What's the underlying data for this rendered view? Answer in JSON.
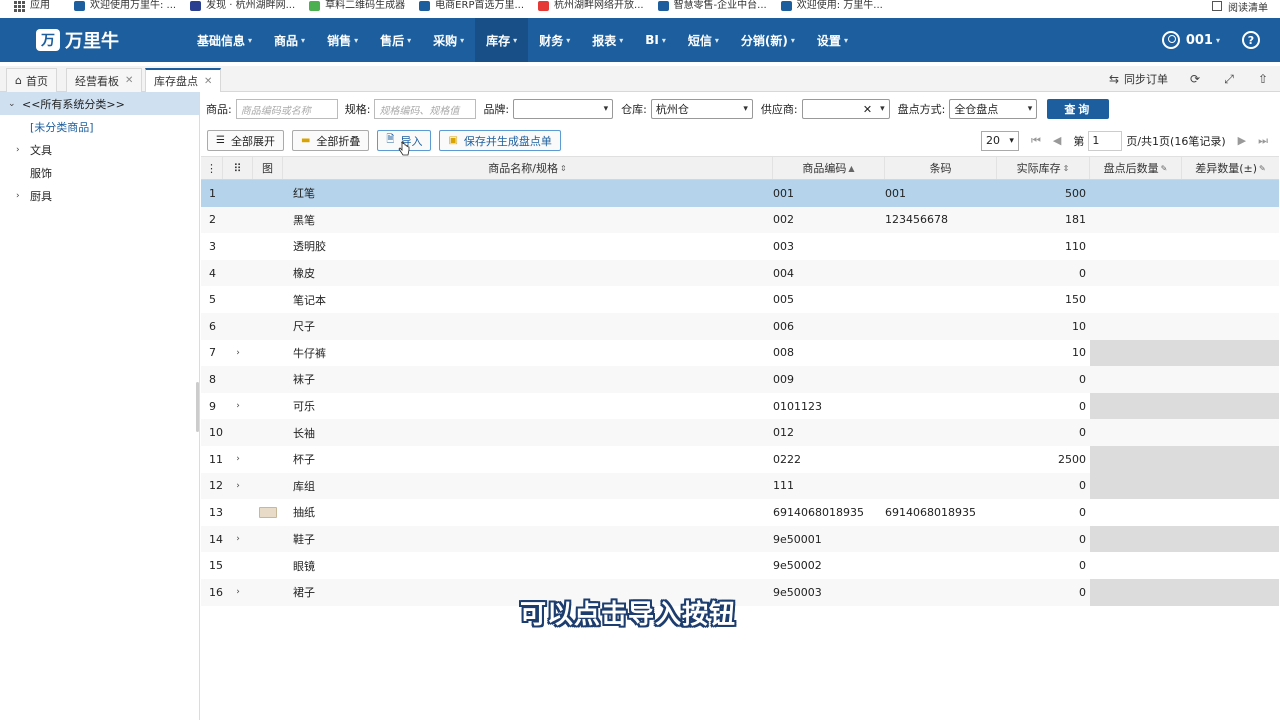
{
  "bookmarks": {
    "apps_label": "应用",
    "items": [
      {
        "label": "欢迎使用万里牛: ...",
        "color": "#1d5f9e"
      },
      {
        "label": "发现 · 杭州湖畔网...",
        "color": "#2a3f8f"
      },
      {
        "label": "草料二维码生成器",
        "color": "#4caf50"
      },
      {
        "label": "电商ERP首选万里...",
        "color": "#1d5f9e"
      },
      {
        "label": "杭州湖畔网络开放...",
        "color": "#e53935"
      },
      {
        "label": "智慧零售-企业中台...",
        "color": "#1d5f9e"
      },
      {
        "label": "欢迎使用: 万里牛...",
        "color": "#1d5f9e"
      }
    ],
    "reading_list": "阅读清单"
  },
  "header": {
    "logo_text": "万里牛",
    "menu": [
      {
        "label": "基础信息",
        "active": false
      },
      {
        "label": "商品",
        "active": false
      },
      {
        "label": "销售",
        "active": false
      },
      {
        "label": "售后",
        "active": false
      },
      {
        "label": "采购",
        "active": false
      },
      {
        "label": "库存",
        "active": true
      },
      {
        "label": "财务",
        "active": false
      },
      {
        "label": "报表",
        "active": false
      },
      {
        "label": "BI",
        "active": false
      },
      {
        "label": "短信",
        "active": false
      },
      {
        "label": "分销(新)",
        "active": false
      },
      {
        "label": "设置",
        "active": false
      }
    ],
    "user": "001"
  },
  "tabs": {
    "items": [
      {
        "label": "首页"
      },
      {
        "label": "经营看板"
      },
      {
        "label": "库存盘点"
      }
    ],
    "sync_label": "同步订单"
  },
  "sidebar": {
    "root": "<<所有系统分类>>",
    "items": [
      {
        "label": "[未分类商品]"
      },
      {
        "label": "文具"
      },
      {
        "label": "服饰"
      },
      {
        "label": "厨具"
      }
    ]
  },
  "filters": {
    "product_label": "商品:",
    "product_placeholder": "商品编码或名称",
    "spec_label": "规格:",
    "spec_placeholder": "规格编码、规格值",
    "brand_label": "品牌:",
    "brand_value": "",
    "warehouse_label": "仓库:",
    "warehouse_value": "杭州仓",
    "supplier_label": "供应商:",
    "supplier_value": "",
    "method_label": "盘点方式:",
    "method_value": "全仓盘点",
    "query_label": "查询"
  },
  "actions": {
    "expand_all": "全部展开",
    "collapse_all": "全部折叠",
    "import": "导入",
    "save_generate": "保存并生成盘点单"
  },
  "pager": {
    "page_size": "20",
    "page_prefix": "第",
    "page_value": "1",
    "page_suffix": "页/共1页(16笔记录)"
  },
  "table": {
    "headers": {
      "image": "图",
      "name": "商品名称/规格",
      "code": "商品编码",
      "barcode": "条码",
      "stock": "实际库存",
      "counted": "盘点后数量",
      "diff": "差异数量(±)"
    },
    "rows": [
      {
        "num": "1",
        "expand": false,
        "image": false,
        "name": "红笔",
        "code": "001",
        "barcode": "001",
        "stock": "500",
        "grey": false
      },
      {
        "num": "2",
        "expand": false,
        "image": false,
        "name": "黑笔",
        "code": "002",
        "barcode": "123456678",
        "stock": "181",
        "grey": false
      },
      {
        "num": "3",
        "expand": false,
        "image": false,
        "name": "透明胶",
        "code": "003",
        "barcode": "",
        "stock": "110",
        "grey": false
      },
      {
        "num": "4",
        "expand": false,
        "image": false,
        "name": "橡皮",
        "code": "004",
        "barcode": "",
        "stock": "0",
        "grey": false
      },
      {
        "num": "5",
        "expand": false,
        "image": false,
        "name": "笔记本",
        "code": "005",
        "barcode": "",
        "stock": "150",
        "grey": false
      },
      {
        "num": "6",
        "expand": false,
        "image": false,
        "name": "尺子",
        "code": "006",
        "barcode": "",
        "stock": "10",
        "grey": false
      },
      {
        "num": "7",
        "expand": true,
        "image": false,
        "name": "牛仔裤",
        "code": "008",
        "barcode": "",
        "stock": "10",
        "grey": true
      },
      {
        "num": "8",
        "expand": false,
        "image": false,
        "name": "袜子",
        "code": "009",
        "barcode": "",
        "stock": "0",
        "grey": false
      },
      {
        "num": "9",
        "expand": true,
        "image": false,
        "name": "可乐",
        "code": "0101123",
        "barcode": "",
        "stock": "0",
        "grey": true
      },
      {
        "num": "10",
        "expand": false,
        "image": false,
        "name": "长袖",
        "code": "012",
        "barcode": "",
        "stock": "0",
        "grey": false
      },
      {
        "num": "11",
        "expand": true,
        "image": false,
        "name": "杯子",
        "code": "0222",
        "barcode": "",
        "stock": "2500",
        "grey": true
      },
      {
        "num": "12",
        "expand": true,
        "image": false,
        "name": "库组",
        "code": "111",
        "barcode": "",
        "stock": "0",
        "grey": true
      },
      {
        "num": "13",
        "expand": false,
        "image": true,
        "name": "抽纸",
        "code": "6914068018935",
        "barcode": "6914068018935",
        "stock": "0",
        "grey": false
      },
      {
        "num": "14",
        "expand": true,
        "image": false,
        "name": "鞋子",
        "code": "9e50001",
        "barcode": "",
        "stock": "0",
        "grey": true
      },
      {
        "num": "15",
        "expand": false,
        "image": false,
        "name": "眼镜",
        "code": "9e50002",
        "barcode": "",
        "stock": "0",
        "grey": false
      },
      {
        "num": "16",
        "expand": true,
        "image": false,
        "name": "裙子",
        "code": "9e50003",
        "barcode": "",
        "stock": "0",
        "grey": true
      }
    ]
  },
  "subtitle": "可以点击导入按钮"
}
